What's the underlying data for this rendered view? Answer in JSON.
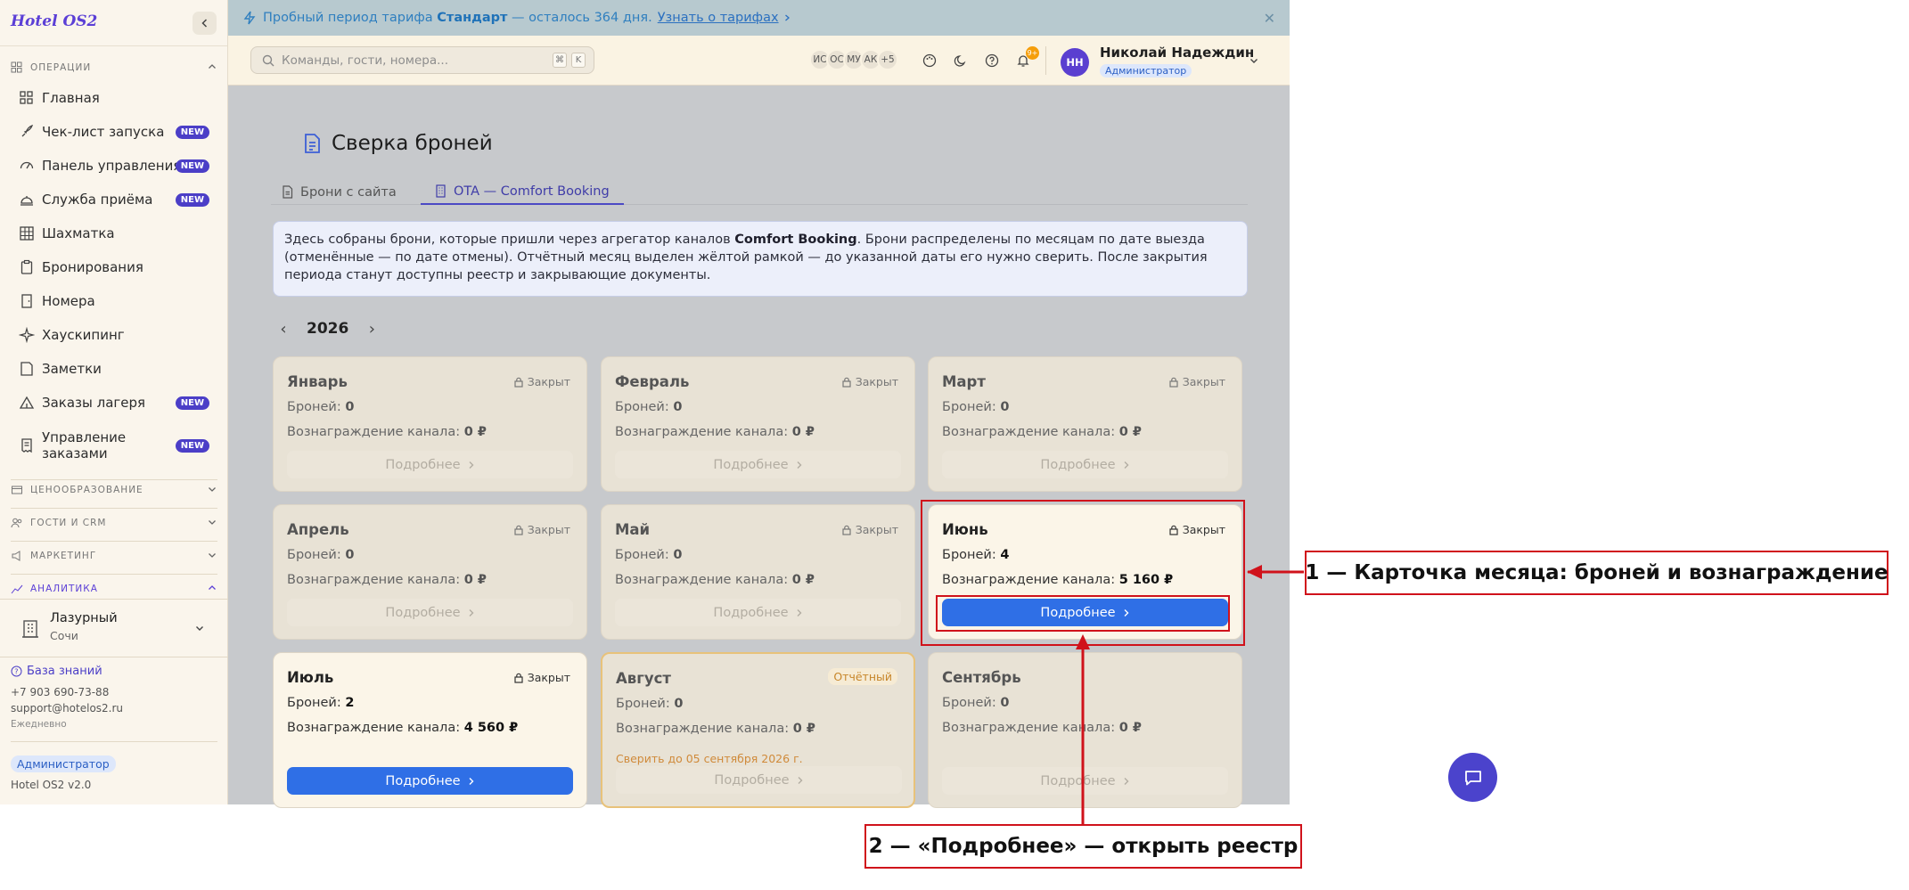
{
  "app": {
    "logo": "Hotel OS2"
  },
  "banner": {
    "pre": "Пробный период тарифа",
    "plan": "Стандарт",
    "post": "— осталось 364 дня.",
    "link": "Узнать о тарифах"
  },
  "sidebar": {
    "section_ops": "ОПЕРАЦИИ",
    "new_label": "NEW",
    "items": [
      {
        "label": "Главная",
        "icon": "dashboard-icon",
        "new": false
      },
      {
        "label": "Чек-лист запуска",
        "icon": "rocket-icon",
        "new": true
      },
      {
        "label": "Панель управления",
        "icon": "gauge-icon",
        "new": true
      },
      {
        "label": "Служба приёма",
        "icon": "bell-desk-icon",
        "new": true
      },
      {
        "label": "Шахматка",
        "icon": "grid-icon",
        "new": false
      },
      {
        "label": "Бронирования",
        "icon": "clipboard-icon",
        "new": false
      },
      {
        "label": "Номера",
        "icon": "door-icon",
        "new": false
      },
      {
        "label": "Хаускипинг",
        "icon": "sparkle-icon",
        "new": false
      },
      {
        "label": "Заметки",
        "icon": "note-icon",
        "new": false
      },
      {
        "label": "Заказы лагеря",
        "icon": "tent-icon",
        "new": true
      },
      {
        "label": "Управление заказами",
        "icon": "receipt-icon",
        "new": true
      }
    ],
    "sections": [
      "ЦЕНООБРАЗОВАНИЕ",
      "ГОСТИ И CRM",
      "МАРКЕТИНГ",
      "АНАЛИТИКА"
    ],
    "hotel": {
      "name": "Лазурный",
      "city": "Сочи"
    },
    "footer": {
      "kb": "База знаний",
      "phone": "+7 903 690-73-88",
      "email": "support@hotelos2.ru",
      "hours": "Ежедневно",
      "role": "Администратор",
      "version": "Hotel OS2 v2.0"
    }
  },
  "topbar": {
    "search_placeholder": "Команды, гости, номера...",
    "kbd": [
      "⌘",
      "K"
    ],
    "avatars": [
      "ИС",
      "ОС",
      "МУ",
      "АК",
      "+5"
    ],
    "notif_count": "9+",
    "user": {
      "initials": "НН",
      "name": "Николай Надеждин",
      "role": "Администратор"
    }
  },
  "page": {
    "title": "Сверка броней",
    "tabs": [
      {
        "label": "Брони с сайта",
        "active": false
      },
      {
        "label": "OTA — Comfort Booking",
        "active": true
      }
    ],
    "info": {
      "p1": "Здесь собраны брони, которые пришли через агрегатор каналов ",
      "bold": "Comfort Booking",
      "p2": ". Брони распределены по месяцам по дате выезда (отменённые — по дате отмены). Отчётный месяц выделен жёлтой рамкой — до указанной даты его нужно сверить. После закрытия периода станут доступны реестр и закрывающие документы."
    },
    "year": "2026",
    "labels": {
      "bookings": "Броней:",
      "reward": "Вознаграждение канала:",
      "details": "Подробнее"
    },
    "months": [
      {
        "name": "Январь",
        "status": "Закрыт",
        "bookings": "0",
        "reward": "0 ₽",
        "state": "closed"
      },
      {
        "name": "Февраль",
        "status": "Закрыт",
        "bookings": "0",
        "reward": "0 ₽",
        "state": "closed"
      },
      {
        "name": "Март",
        "status": "Закрыт",
        "bookings": "0",
        "reward": "0 ₽",
        "state": "closed"
      },
      {
        "name": "Апрель",
        "status": "Закрыт",
        "bookings": "0",
        "reward": "0 ₽",
        "state": "closed"
      },
      {
        "name": "Май",
        "status": "Закрыт",
        "bookings": "0",
        "reward": "0 ₽",
        "state": "closed"
      },
      {
        "name": "Июнь",
        "status": "Закрыт",
        "bookings": "4",
        "reward": "5 160 ₽",
        "state": "active"
      },
      {
        "name": "Июль",
        "status": "Закрыт",
        "bookings": "2",
        "reward": "4 560 ₽",
        "state": "active"
      },
      {
        "name": "Август",
        "status": "Отчётный",
        "bookings": "0",
        "reward": "0 ₽",
        "state": "report",
        "deadline": "Сверить до 05 сентября 2026 г."
      },
      {
        "name": "Сентябрь",
        "status": "",
        "bookings": "0",
        "reward": "0 ₽",
        "state": "future"
      }
    ]
  },
  "annotations": {
    "callout1": "1 — Карточка месяца: броней и вознаграждение",
    "callout2": "2 — «Подробнее» — открыть реестр",
    "color": "#d0121b"
  }
}
